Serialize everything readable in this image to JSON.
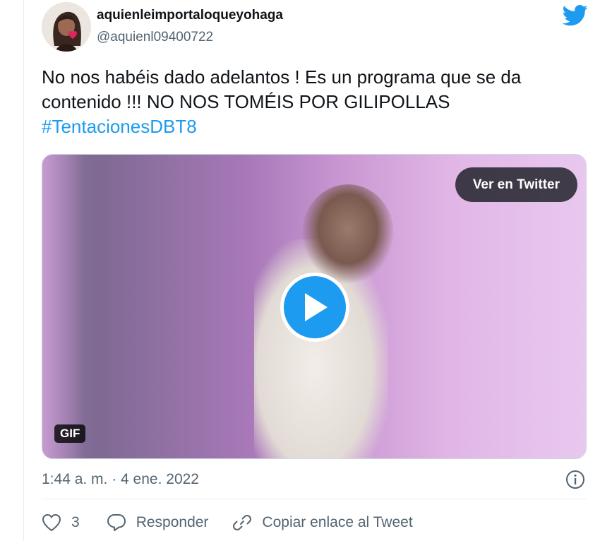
{
  "author": {
    "display_name": "aquienleimportaloqueyohaga",
    "handle": "@aquienl09400722",
    "avatar_icon": "memoji-avatar"
  },
  "brand": {
    "logo_icon": "twitter-bird-icon",
    "accent_color": "#1d9bf0"
  },
  "tweet": {
    "text": "No nos habéis dado adelantos ! Es un programa que se da contenido !!! NO NOS TOMÉIS POR GILIPOLLAS",
    "hashtag": "#TentacionesDBT8"
  },
  "media": {
    "view_button_label": "Ver en Twitter",
    "play_icon": "play-icon",
    "badge_label": "GIF"
  },
  "meta": {
    "timestamp": "1:44 a. m. · 4 ene. 2022",
    "info_icon": "info-icon"
  },
  "actions": {
    "like_count": "3",
    "reply_label": "Responder",
    "copy_link_label": "Copiar enlace al Tweet"
  }
}
